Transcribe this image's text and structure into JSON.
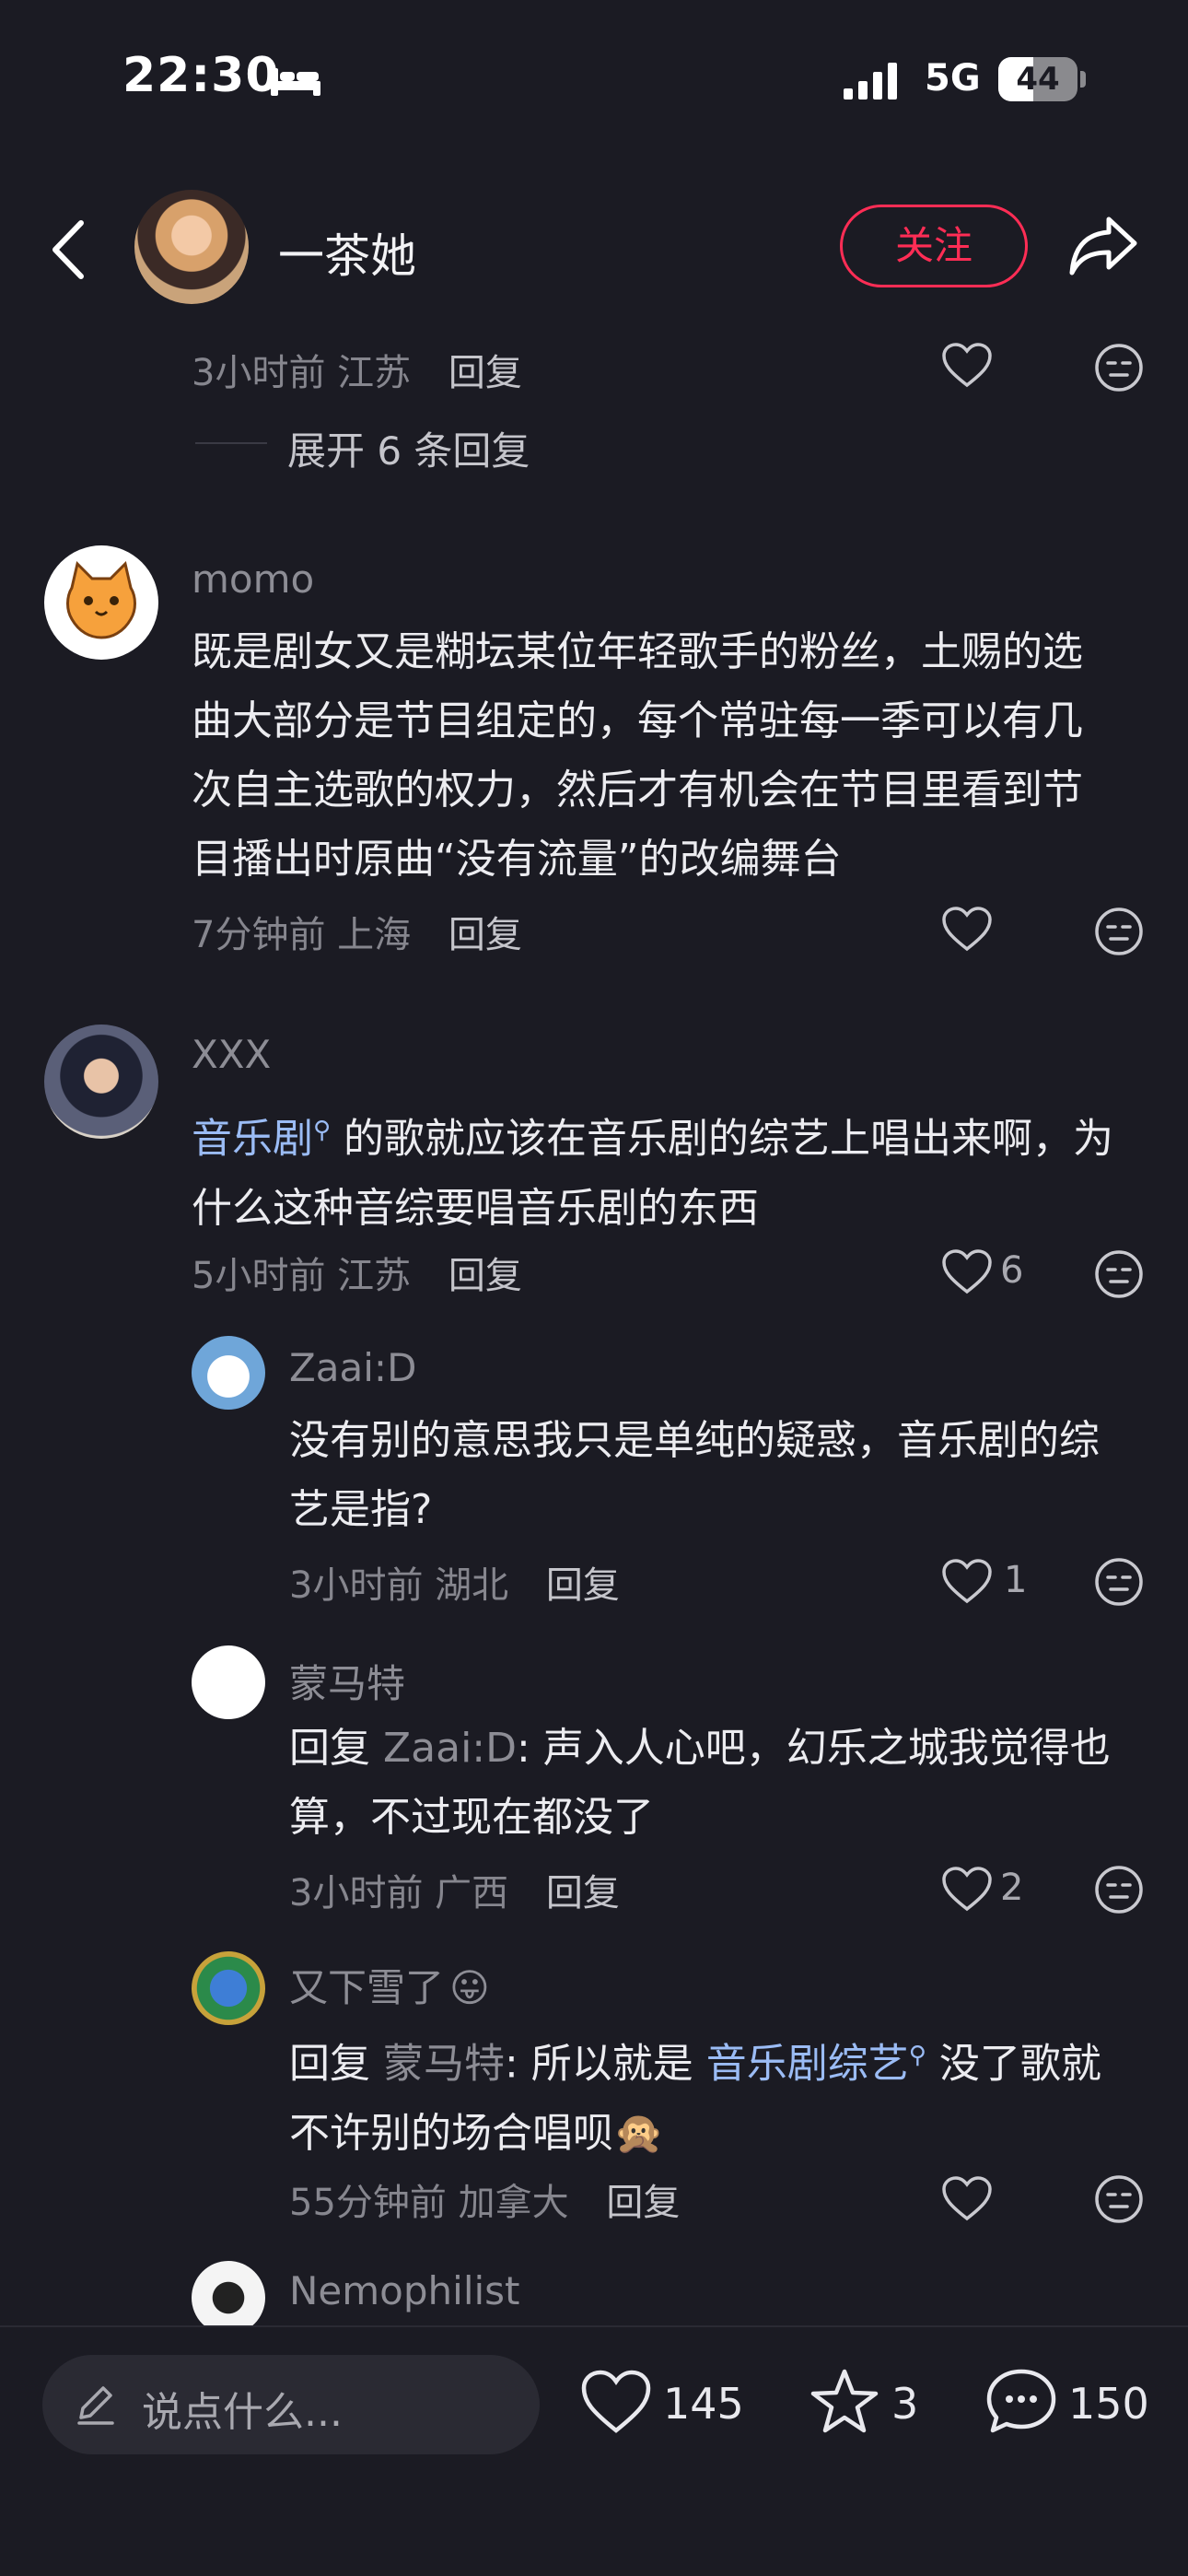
{
  "status": {
    "time": "22:30",
    "network": "5G",
    "battery": "44",
    "battery_level": 0.44
  },
  "header": {
    "username": "一茶她",
    "follow_label": "关注",
    "icons": {
      "back": "chevron-left-icon",
      "share": "share-arrow-icon",
      "sleep": "bed-icon"
    }
  },
  "top_comment": {
    "meta": "3小时前 江苏",
    "reply_label": "回复",
    "expand_label": "展开 6 条回复"
  },
  "comments": [
    {
      "author": "momo",
      "text": "既是剧女又是糊坛某位年轻歌手的粉丝，土赐的选曲大部分是节目组定的，每个常驻每一季可以有几次自主选歌的权力，然后才有机会在节目里看到节目播出时原曲“没有流量”的改编舞台",
      "meta": "7分钟前 上海",
      "reply_label": "回复",
      "likes": ""
    },
    {
      "author": "XXX",
      "link_text": "音乐剧",
      "text": " 的歌就应该在音乐剧的综艺上唱出来啊，为什么这种音综要唱音乐剧的东西",
      "meta": "5小时前 江苏",
      "reply_label": "回复",
      "likes": "6"
    }
  ],
  "replies": [
    {
      "author": "Zaai:D",
      "text": "没有别的意思我只是单纯的疑惑，音乐剧的综艺是指?",
      "meta": "3小时前 湖北",
      "reply_label": "回复",
      "likes": "1"
    },
    {
      "author": "蒙马特",
      "prefix": "回复 ",
      "mention": "Zaai:D",
      "text": ": 声入人心吧，幻乐之城我觉得也算，不过现在都没了",
      "meta": "3小时前 广西",
      "reply_label": "回复",
      "likes": "2"
    },
    {
      "author": "又下雪了",
      "author_emoji": "😛",
      "prefix": "回复 ",
      "mention": "蒙马特",
      "text_a": ": 所以就是 ",
      "link_text": "音乐剧综艺",
      "text_b": " 没了歌就不许别的场合唱呗",
      "trailing_emoji": "🙊",
      "meta": "55分钟前 加拿大",
      "reply_label": "回复",
      "likes": ""
    },
    {
      "author": "Nemophilist"
    }
  ],
  "bottom_bar": {
    "placeholder": "说点什么...",
    "likes": "145",
    "favorites": "3",
    "comments": "150"
  },
  "colors": {
    "background": "#1b1b23",
    "accent": "#ff2d55",
    "link": "#9bbcf5"
  }
}
